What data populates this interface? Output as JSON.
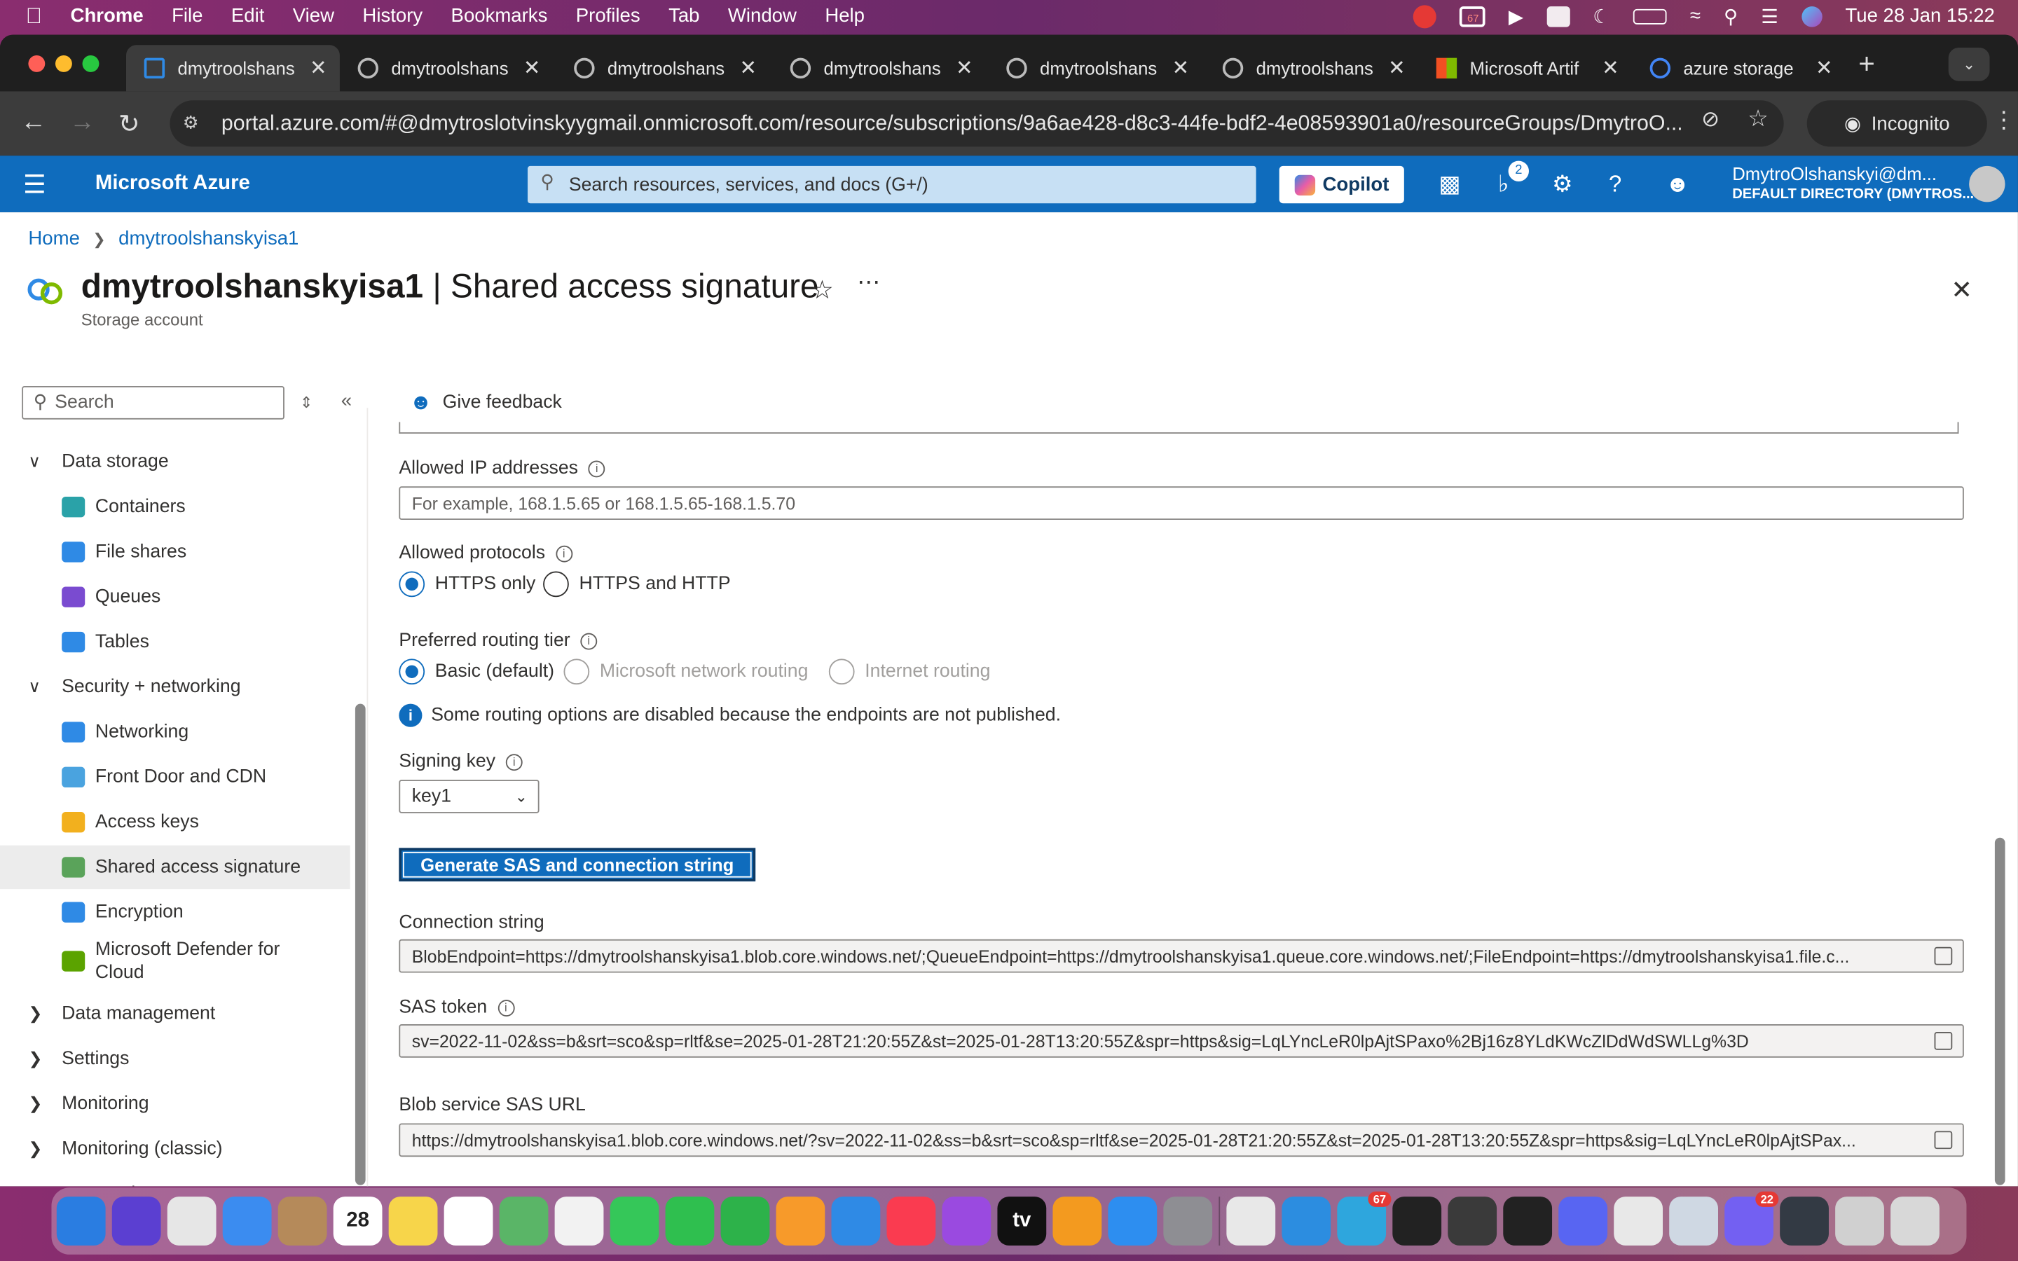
{
  "menubar": {
    "app": "Chrome",
    "items": [
      "File",
      "Edit",
      "View",
      "History",
      "Bookmarks",
      "Profiles",
      "Tab",
      "Window",
      "Help"
    ],
    "clock": "Tue 28 Jan  15:22",
    "badge": "67"
  },
  "tabs": [
    {
      "title": "dmytroolshans",
      "active": true
    },
    {
      "title": "dmytroolshans"
    },
    {
      "title": "dmytroolshans"
    },
    {
      "title": "dmytroolshans"
    },
    {
      "title": "dmytroolshans"
    },
    {
      "title": "dmytroolshans"
    },
    {
      "title": "Microsoft Artif"
    },
    {
      "title": "azure storage"
    }
  ],
  "address": {
    "url": "portal.azure.com/#@dmytroslotvinskyygmail.onmicrosoft.com/resource/subscriptions/9a6ae428-d8c3-44fe-bdf2-4e08593901a0/resourceGroups/DmytroO...",
    "incognito": "Incognito"
  },
  "azure": {
    "brand": "Microsoft Azure",
    "search_placeholder": "Search resources, services, and docs (G+/)",
    "copilot": "Copilot",
    "notif_count": "2",
    "account_name": "DmytroOlshanskyi@dm...",
    "account_dir": "DEFAULT DIRECTORY (DMYTROS..."
  },
  "breadcrumb": {
    "home": "Home",
    "resource": "dmytroolshanskyisa1"
  },
  "page": {
    "resource": "dmytroolshanskyisa1",
    "section": " | Shared access signature",
    "subtitle": "Storage account"
  },
  "sidebar": {
    "search_placeholder": "Search",
    "items": [
      {
        "type": "group",
        "label": "Data storage",
        "expanded": true
      },
      {
        "type": "item",
        "label": "Containers",
        "icon": "containers-icon"
      },
      {
        "type": "item",
        "label": "File shares",
        "icon": "file-shares-icon"
      },
      {
        "type": "item",
        "label": "Queues",
        "icon": "queues-icon"
      },
      {
        "type": "item",
        "label": "Tables",
        "icon": "tables-icon"
      },
      {
        "type": "group",
        "label": "Security + networking",
        "expanded": true
      },
      {
        "type": "item",
        "label": "Networking",
        "icon": "networking-icon"
      },
      {
        "type": "item",
        "label": "Front Door and CDN",
        "icon": "cdn-icon"
      },
      {
        "type": "item",
        "label": "Access keys",
        "icon": "key-icon"
      },
      {
        "type": "item",
        "label": "Shared access signature",
        "icon": "sas-icon",
        "selected": true
      },
      {
        "type": "item",
        "label": "Encryption",
        "icon": "lock-icon"
      },
      {
        "type": "item",
        "label": "Microsoft Defender for Cloud",
        "icon": "defender-icon"
      },
      {
        "type": "group",
        "label": "Data management",
        "expanded": false
      },
      {
        "type": "group",
        "label": "Settings",
        "expanded": false
      },
      {
        "type": "group",
        "label": "Monitoring",
        "expanded": false
      },
      {
        "type": "group",
        "label": "Monitoring (classic)",
        "expanded": false
      },
      {
        "type": "group",
        "label": "Automation",
        "expanded": false
      }
    ]
  },
  "toolbar": {
    "feedback": "Give feedback"
  },
  "form": {
    "ip_label": "Allowed IP addresses",
    "ip_placeholder": "For example, 168.1.5.65 or 168.1.5.65-168.1.5.70",
    "protocols_label": "Allowed protocols",
    "protocol_https": "HTTPS only",
    "protocol_both": "HTTPS and HTTP",
    "routing_label": "Preferred routing tier",
    "routing_basic": "Basic (default)",
    "routing_msft": "Microsoft network routing",
    "routing_internet": "Internet routing",
    "routing_note": "Some routing options are disabled because the endpoints are not published.",
    "signing_label": "Signing key",
    "signing_value": "key1",
    "generate": "Generate SAS and connection string",
    "conn_label": "Connection string",
    "conn_value": "BlobEndpoint=https://dmytroolshanskyisa1.blob.core.windows.net/;QueueEndpoint=https://dmytroolshanskyisa1.queue.core.windows.net/;FileEndpoint=https://dmytroolshanskyisa1.file.c...",
    "sas_label": "SAS token",
    "sas_value": "sv=2022-11-02&ss=b&srt=sco&sp=rltf&se=2025-01-28T21:20:55Z&st=2025-01-28T13:20:55Z&spr=https&sig=LqLYncLeR0lpAjtSPaxo%2Bj16z8YLdKWcZlDdWdSWLLg%3D",
    "blob_label": "Blob service SAS URL",
    "blob_value": "https://dmytroolshanskyisa1.blob.core.windows.net/?sv=2022-11-02&ss=b&srt=sco&sp=rltf&se=2025-01-28T21:20:55Z&st=2025-01-28T13:20:55Z&spr=https&sig=LqLYncLeR0lpAjtSPax..."
  },
  "dock": {
    "apps": [
      {
        "name": "finder",
        "color": "#2a7de1"
      },
      {
        "name": "siri",
        "color": "#5b3fd1"
      },
      {
        "name": "launchpad",
        "color": "#e6e6e6"
      },
      {
        "name": "mail",
        "color": "#3b8cf0"
      },
      {
        "name": "contacts",
        "color": "#b58a5a"
      },
      {
        "name": "calendar",
        "color": "#ffffff",
        "label": "28",
        "sub": "JAN"
      },
      {
        "name": "notes",
        "color": "#f7d54a"
      },
      {
        "name": "reminders",
        "color": "#ffffff"
      },
      {
        "name": "maps",
        "color": "#5ab567"
      },
      {
        "name": "photos",
        "color": "#f2f2f2"
      },
      {
        "name": "messages",
        "color": "#35c759"
      },
      {
        "name": "facetime",
        "color": "#2fbf4f"
      },
      {
        "name": "numbers",
        "color": "#2db24a"
      },
      {
        "name": "pages",
        "color": "#f79a2a"
      },
      {
        "name": "keynote",
        "color": "#2f8ae5"
      },
      {
        "name": "music",
        "color": "#fa3b50"
      },
      {
        "name": "podcasts",
        "color": "#9a4ae0"
      },
      {
        "name": "tv",
        "color": "#111111",
        "label": "tv"
      },
      {
        "name": "books",
        "color": "#f39a1f"
      },
      {
        "name": "appstore",
        "color": "#2d8ef0"
      },
      {
        "name": "settings",
        "color": "#8e8e93"
      },
      {
        "name": "chrome",
        "color": "#e8e8e8"
      },
      {
        "name": "vscode",
        "color": "#2c8de0"
      },
      {
        "name": "telegram",
        "color": "#2ea6dd",
        "badge": "67"
      },
      {
        "name": "terminal",
        "color": "#222222"
      },
      {
        "name": "sublime",
        "color": "#3a3a3a"
      },
      {
        "name": "activity-monitor",
        "color": "#222222"
      },
      {
        "name": "discord",
        "color": "#5865f2"
      },
      {
        "name": "azure-data-studio",
        "color": "#e8e8e8"
      },
      {
        "name": "preview",
        "color": "#cfd8e3"
      },
      {
        "name": "viber",
        "color": "#7360f2",
        "badge": "22"
      },
      {
        "name": "window-1",
        "color": "#333a44"
      },
      {
        "name": "window-2",
        "color": "#d0d0d0"
      },
      {
        "name": "trash",
        "color": "#d8d8d8"
      }
    ]
  },
  "colors": {
    "azure_blue": "#0f6cbd",
    "menubar_bg": "#8a2d6f"
  }
}
